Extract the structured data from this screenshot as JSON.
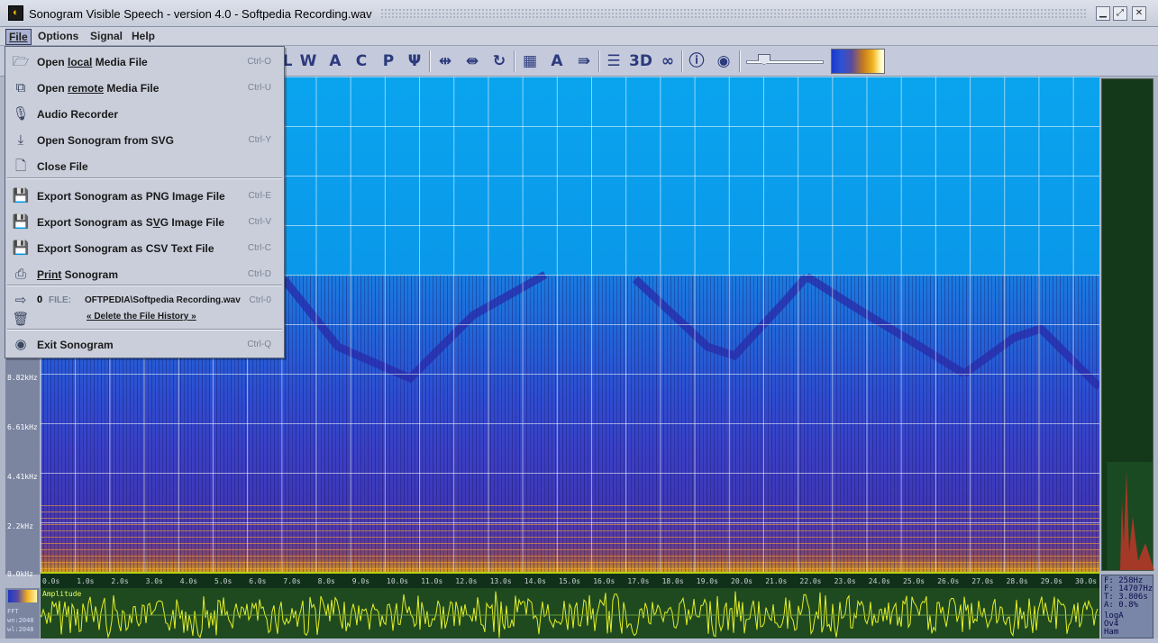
{
  "window": {
    "title": "Sonogram Visible Speech - version 4.0 - Softpedia Recording.wav",
    "icon": "sonogram-app-icon",
    "buttons": [
      "minimize-icon",
      "maximize-icon",
      "close-icon"
    ]
  },
  "menubar": {
    "file": "File",
    "options": "Options",
    "signal": "Signal",
    "help": "Help"
  },
  "toolbar": {
    "letters": [
      "W",
      "A",
      "C",
      "P",
      "Ψ"
    ],
    "three_d": "3D",
    "icons": [
      "play-icon",
      "stop-icon",
      "loop-icon",
      "grid-icon",
      "font-icon",
      "forward-icon",
      "list-icon",
      "3d-icon",
      "binoculars-icon",
      "info-icon",
      "end-icon"
    ],
    "slider_value": 0.18
  },
  "file_menu": {
    "items": [
      {
        "icon": "folder-open-icon",
        "label_pre": "Open ",
        "label_u": "local",
        "label_post": " Media File",
        "shortcut": "Ctrl-O"
      },
      {
        "icon": "network-icon",
        "label_pre": "Open ",
        "label_u": "remote",
        "label_post": " Media File",
        "shortcut": "Ctrl-U"
      },
      {
        "icon": "microphone-icon",
        "label_pre": "Audio Recorder",
        "label_u": "",
        "label_post": "",
        "shortcut": ""
      },
      {
        "icon": "import-svg-icon",
        "label_pre": "Open Sonogram from SVG",
        "label_u": "",
        "label_post": "",
        "shortcut": "Ctrl-Y"
      },
      {
        "icon": "close-file-icon",
        "label_pre": "Close File",
        "label_u": "",
        "label_post": "",
        "shortcut": ""
      },
      {
        "icon": "export-png-icon",
        "label_pre": "Export Sonogram as PNG Image File",
        "label_u": "",
        "label_post": "",
        "shortcut": "Ctrl-E"
      },
      {
        "icon": "export-svg-icon",
        "label_pre": "Export Sonogram as S",
        "label_u": "V",
        "label_post": "G Image File",
        "shortcut": "Ctrl-V"
      },
      {
        "icon": "export-csv-icon",
        "label_pre": "Export Sonogram as CSV Text File",
        "label_u": "",
        "label_post": "",
        "shortcut": "Ctrl-C"
      },
      {
        "icon": "printer-icon",
        "label_pre": "",
        "label_u": "Print",
        "label_post": " Sonogram",
        "shortcut": "Ctrl-D"
      }
    ],
    "history": {
      "index": "0",
      "file_label": "FILE:",
      "path": "OFTPEDIA\\Softpedia Recording.wav",
      "shortcut": "Ctrl-0",
      "delete": "« Delete the File History »"
    },
    "exit": {
      "label": "Exit Sonogram",
      "shortcut": "Ctrl-Q"
    }
  },
  "spectrogram": {
    "y_labels": [
      "8.82kHz",
      "6.61kHz",
      "4.41kHz",
      "2.2kHz",
      "0.0kHz"
    ],
    "time_labels": [
      "0.0s",
      "1.0s",
      "2.0s",
      "3.0s",
      "4.0s",
      "5.0s",
      "6.0s",
      "7.0s",
      "8.0s",
      "9.0s",
      "10.0s",
      "11.0s",
      "12.0s",
      "13.0s",
      "14.0s",
      "15.0s",
      "16.0s",
      "17.0s",
      "18.0s",
      "19.0s",
      "20.0s",
      "21.0s",
      "22.0s",
      "23.0s",
      "24.0s",
      "25.0s",
      "26.0s",
      "27.0s",
      "28.0s",
      "29.0s",
      "30.0s"
    ]
  },
  "amplitude": {
    "label": "Amplitude",
    "fft": "FFT",
    "win": "wn:2048",
    "wl": "wl:2048"
  },
  "info": {
    "freq": "F: 258Hz",
    "freq2": "F: 14707Hz",
    "time": "T: 3.806s",
    "amp": "A: 0.8%",
    "log": "logA",
    "ov": "Ov4",
    "win": "Ham"
  },
  "colors": {
    "accent": "#2c3a7e",
    "wave": "#e4f028",
    "grid": "#ffffff"
  }
}
